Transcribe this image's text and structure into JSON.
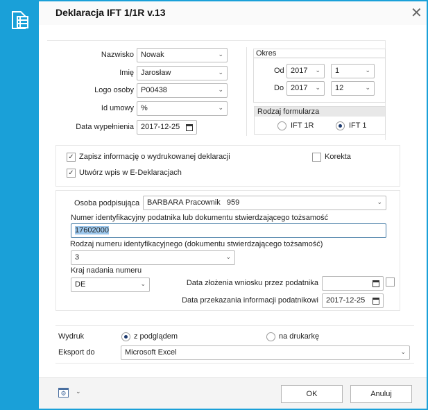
{
  "window": {
    "title": "Deklaracja IFT 1/1R v.13",
    "close_icon": "close-icon",
    "app_icon": "document-table-icon"
  },
  "person": {
    "surname_label": "Nazwisko",
    "surname": "Nowak",
    "name_label": "Imię",
    "name": "Jarosław",
    "code_label": "Logo osoby",
    "code": "P00438",
    "contract_label": "Id umowy",
    "contract": "%",
    "fill_date_label": "Data wypełnienia",
    "fill_date": "2017-12-25"
  },
  "period": {
    "title": "Okres",
    "from_label": "Od",
    "from_year": "2017",
    "from_month": "1",
    "to_label": "Do",
    "to_year": "2017",
    "to_month": "12"
  },
  "form_type": {
    "title": "Rodzaj formularza",
    "options": [
      "IFT 1R",
      "IFT 1"
    ],
    "selected": "IFT 1"
  },
  "options": {
    "save_info": "Zapisz informację o wydrukowanej deklaracji",
    "save_info_checked": true,
    "edecl": "Utwórz wpis w E-Deklaracjach",
    "edecl_checked": true,
    "correction": "Korekta",
    "correction_checked": false
  },
  "signer": {
    "signer_label": "Osoba podpisująca",
    "signer": "BARBARA Pracownik   959",
    "id_label": "Numer identyfikacyjny podatnika lub dokumentu stwierdzającego tożsamość",
    "id_value": "17602000",
    "id_type_label": "Rodzaj numeru identyfikacyjnego (dokumentu stwierdzającego tożsamość)",
    "id_type": "3",
    "country_label": "Kraj nadania numeru",
    "country": "DE",
    "request_date_label": "Data złożenia wniosku przez podatnika",
    "request_date": "",
    "handover_date_label": "Data przekazania informacji podatnikowi",
    "handover_date": "2017-12-25"
  },
  "print": {
    "label": "Wydruk",
    "options": [
      "z podglądem",
      "na drukarkę"
    ],
    "selected": "z podglądem",
    "export_label": "Eksport do",
    "export": "Microsoft Excel"
  },
  "footer": {
    "ok": "OK",
    "cancel": "Anuluj"
  }
}
